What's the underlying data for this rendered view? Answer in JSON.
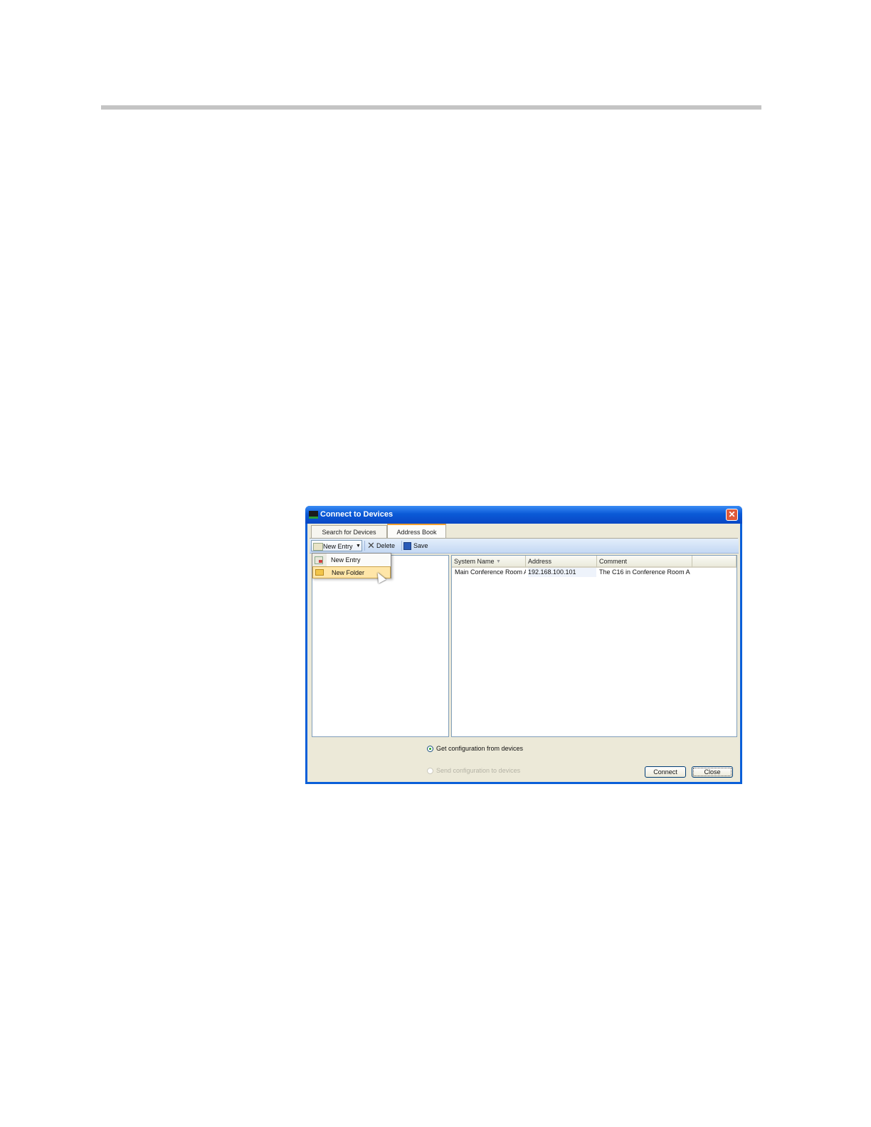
{
  "window": {
    "title": "Connect to Devices",
    "close_glyph": "✕"
  },
  "tabs": [
    {
      "label": "Search for Devices",
      "active": false
    },
    {
      "label": "Address Book",
      "active": true
    }
  ],
  "toolbar": {
    "new_entry_label": "New Entry",
    "dropdown_glyph": "▼",
    "delete_label": "Delete",
    "delete_glyph": "✕",
    "save_label": "Save"
  },
  "menu": {
    "items": [
      {
        "label": "New Entry",
        "icon": "new-entry-icon"
      },
      {
        "label": "New Folder",
        "icon": "folder-icon",
        "highlighted": true
      }
    ]
  },
  "table": {
    "columns": [
      "System Name",
      "Address",
      "Comment"
    ],
    "sort_glyph": "▼",
    "rows": [
      {
        "system_name": "Main Conference Room A",
        "address": "192.168.100.101",
        "comment": "The C16 in Conference Room A"
      }
    ]
  },
  "options": {
    "get_config": "Get configuration from devices",
    "send_config": "Send configuration to devices",
    "selected": "get_config"
  },
  "buttons": {
    "connect": "Connect",
    "close": "Close"
  },
  "colors": {
    "titlebar": "#0b5ad7",
    "menu_highlight": "#ffe6a8",
    "dialog_background": "#ece9d8"
  }
}
